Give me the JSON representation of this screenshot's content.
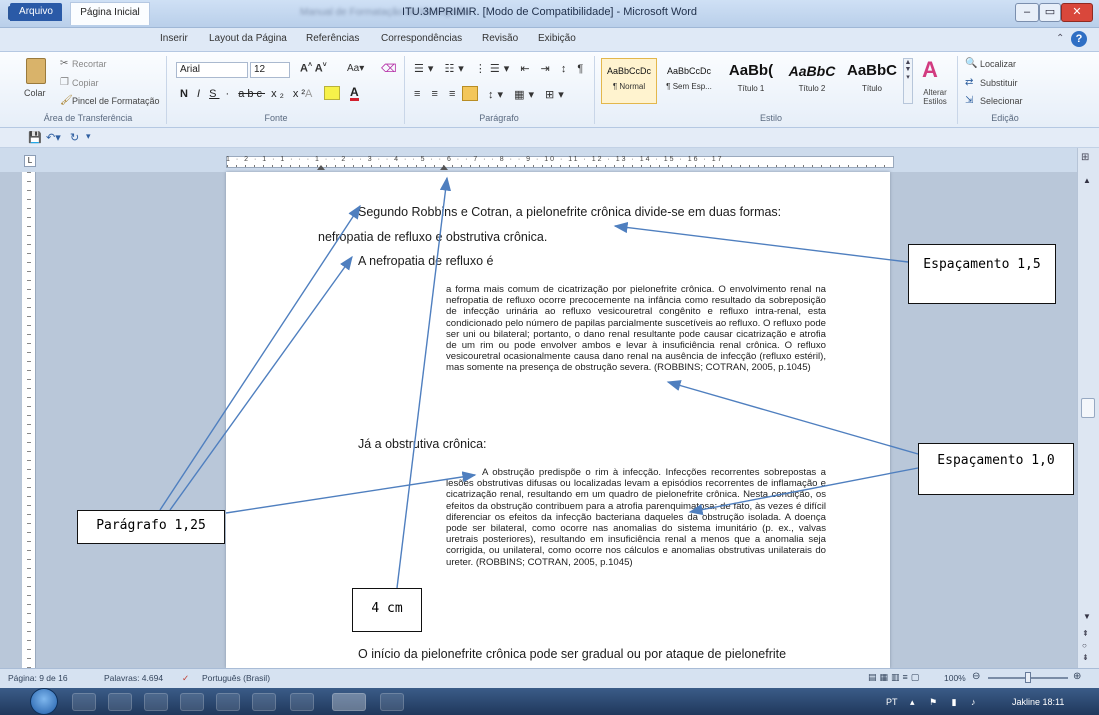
{
  "window": {
    "title": "ITU.3MPRIMIR. [Modo de Compatibilidade] - Microsoft Word",
    "title_blur_left": "Manual de Formatação de Monografia",
    "controls": [
      "–",
      "▭",
      "✕"
    ]
  },
  "tabs": [
    "Arquivo",
    "Página Inicial",
    "Inserir",
    "Layout da Página",
    "Referências",
    "Correspondências",
    "Revisão",
    "Exibição"
  ],
  "ribbon": {
    "clipboard": {
      "paste": "Colar",
      "cut": "Recortar",
      "copy": "Copiar",
      "format_painter": "Pincel de Formatação",
      "label": "Área de Transferência"
    },
    "font": {
      "name": "Arial",
      "size": "12",
      "label": "Fonte"
    },
    "paragraph": {
      "label": "Parágrafo"
    },
    "styles": {
      "items": [
        {
          "preview": "AaBbCcDc",
          "name": "¶ Normal"
        },
        {
          "preview": "AaBbCcDc",
          "name": "¶ Sem Esp..."
        },
        {
          "preview": "AaBb(",
          "name": "Título 1"
        },
        {
          "preview": "AaBbC",
          "name": "Título 2"
        },
        {
          "preview": "AaBbC",
          "name": "Título"
        }
      ],
      "change": "Alterar Estilos",
      "label": "Estilo"
    },
    "editing": {
      "find": "Localizar",
      "replace": "Substituir",
      "select": "Selecionar",
      "label": "Edição"
    }
  },
  "ruler_numbers": "1 · 2 · 1 · 1 · · · 1 · · 2 · · 3 · · 4 · · 5 · · 6 · · 7 · · 8 · · 9 · 10 · 11 · 12 · 13 · 14 · 15 · 16 · 17",
  "document": {
    "p1_line1": "Segundo Robbins e Cotran, a pielonefrite crônica divide-se em duas formas:",
    "p1_line2": "nefropatia de refluxo e obstrutiva crônica.",
    "p2": "A nefropatia de refluxo é",
    "quote1": "a forma mais comum de cicatrização por pielonefrite crônica. O envolvimento renal na nefropatia de refluxo ocorre precocemente na infância como resultado da sobreposição de infecção urinária ao refluxo vesicouretral congênito e refluxo intra-renal, esta condicionado pelo número de papilas parcialmente suscetíveis ao refluxo. O refluxo pode ser uni ou bilateral; portanto, o dano renal resultante pode causar cicatrização e atrofia de um rim ou pode envolver ambos e levar à insuficiência renal crônica. O refluxo vesicouretral ocasionalmente causa dano renal na ausência de infecção (refluxo estéril), mas somente na presença de obstrução severa. (ROBBINS; COTRAN, 2005, p.1045)",
    "p3": "Já a obstrutiva crônica:",
    "quote2": "A obstrução predispõe o rim à infecção. Infecções recorrentes sobrepostas a lesões obstrutivas difusas ou localizadas levam a episódios recorrentes de inflamação e cicatrização renal, resultando em um quadro de pielonefrite crônica. Nesta condição, os efeitos da obstrução contribuem para a atrofia parenquimatosa; de fato, às vezes é difícil diferenciar os efeitos da infecção bacteriana daqueles da obstrução isolada. A doença pode ser bilateral, como ocorre nas anomalias do sistema imunitário (p. ex., valvas uretrais posteriores), resultando em insuficiência renal a menos que a anomalia seja corrigida, ou unilateral, como ocorre nos cálculos e anomalias obstrutivas unilaterais do ureter. (ROBBINS; COTRAN, 2005, p.1045)",
    "p4": "O início da pielonefrite crônica pode ser gradual ou por ataque de pielonefrite"
  },
  "annotations": {
    "spacing_15": "Espaçamento 1,5",
    "spacing_10": "Espaçamento 1,0",
    "paragraph_125": "Parágrafo 1,25",
    "four_cm": "4 cm"
  },
  "status": {
    "page": "Página: 9 de 16",
    "words": "Palavras: 4.694",
    "language": "Português (Brasil)",
    "zoom": "100%"
  },
  "taskbar": {
    "lang": "PT",
    "clock": "Jakline 18:11"
  }
}
